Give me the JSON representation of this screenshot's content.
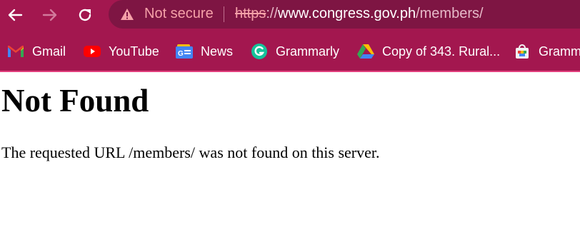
{
  "toolbar": {
    "back_icon": "back-arrow-icon",
    "forward_icon": "forward-arrow-icon",
    "reload_icon": "reload-icon",
    "security_icon": "warning-triangle-icon",
    "security_label": "Not secure",
    "url": {
      "scheme": "https",
      "separator": "://",
      "host": "www.congress.gov.ph",
      "path": "/members/"
    }
  },
  "bookmarks": [
    {
      "label": "Gmail",
      "icon": "gmail-icon"
    },
    {
      "label": "YouTube",
      "icon": "youtube-icon"
    },
    {
      "label": "News",
      "icon": "google-news-icon"
    },
    {
      "label": "Grammarly",
      "icon": "grammarly-icon"
    },
    {
      "label": "Copy of 343. Rural...",
      "icon": "google-drive-icon"
    },
    {
      "label": "Gramm",
      "icon": "bag-icon"
    }
  ],
  "page": {
    "heading": "Not Found",
    "message": "The requested URL /members/ was not found on this server."
  },
  "colors": {
    "frame": "#a3174f",
    "omnibox": "#7e1543",
    "not_secure_text": "#f5a1a8",
    "page_background": "#ffffff"
  }
}
